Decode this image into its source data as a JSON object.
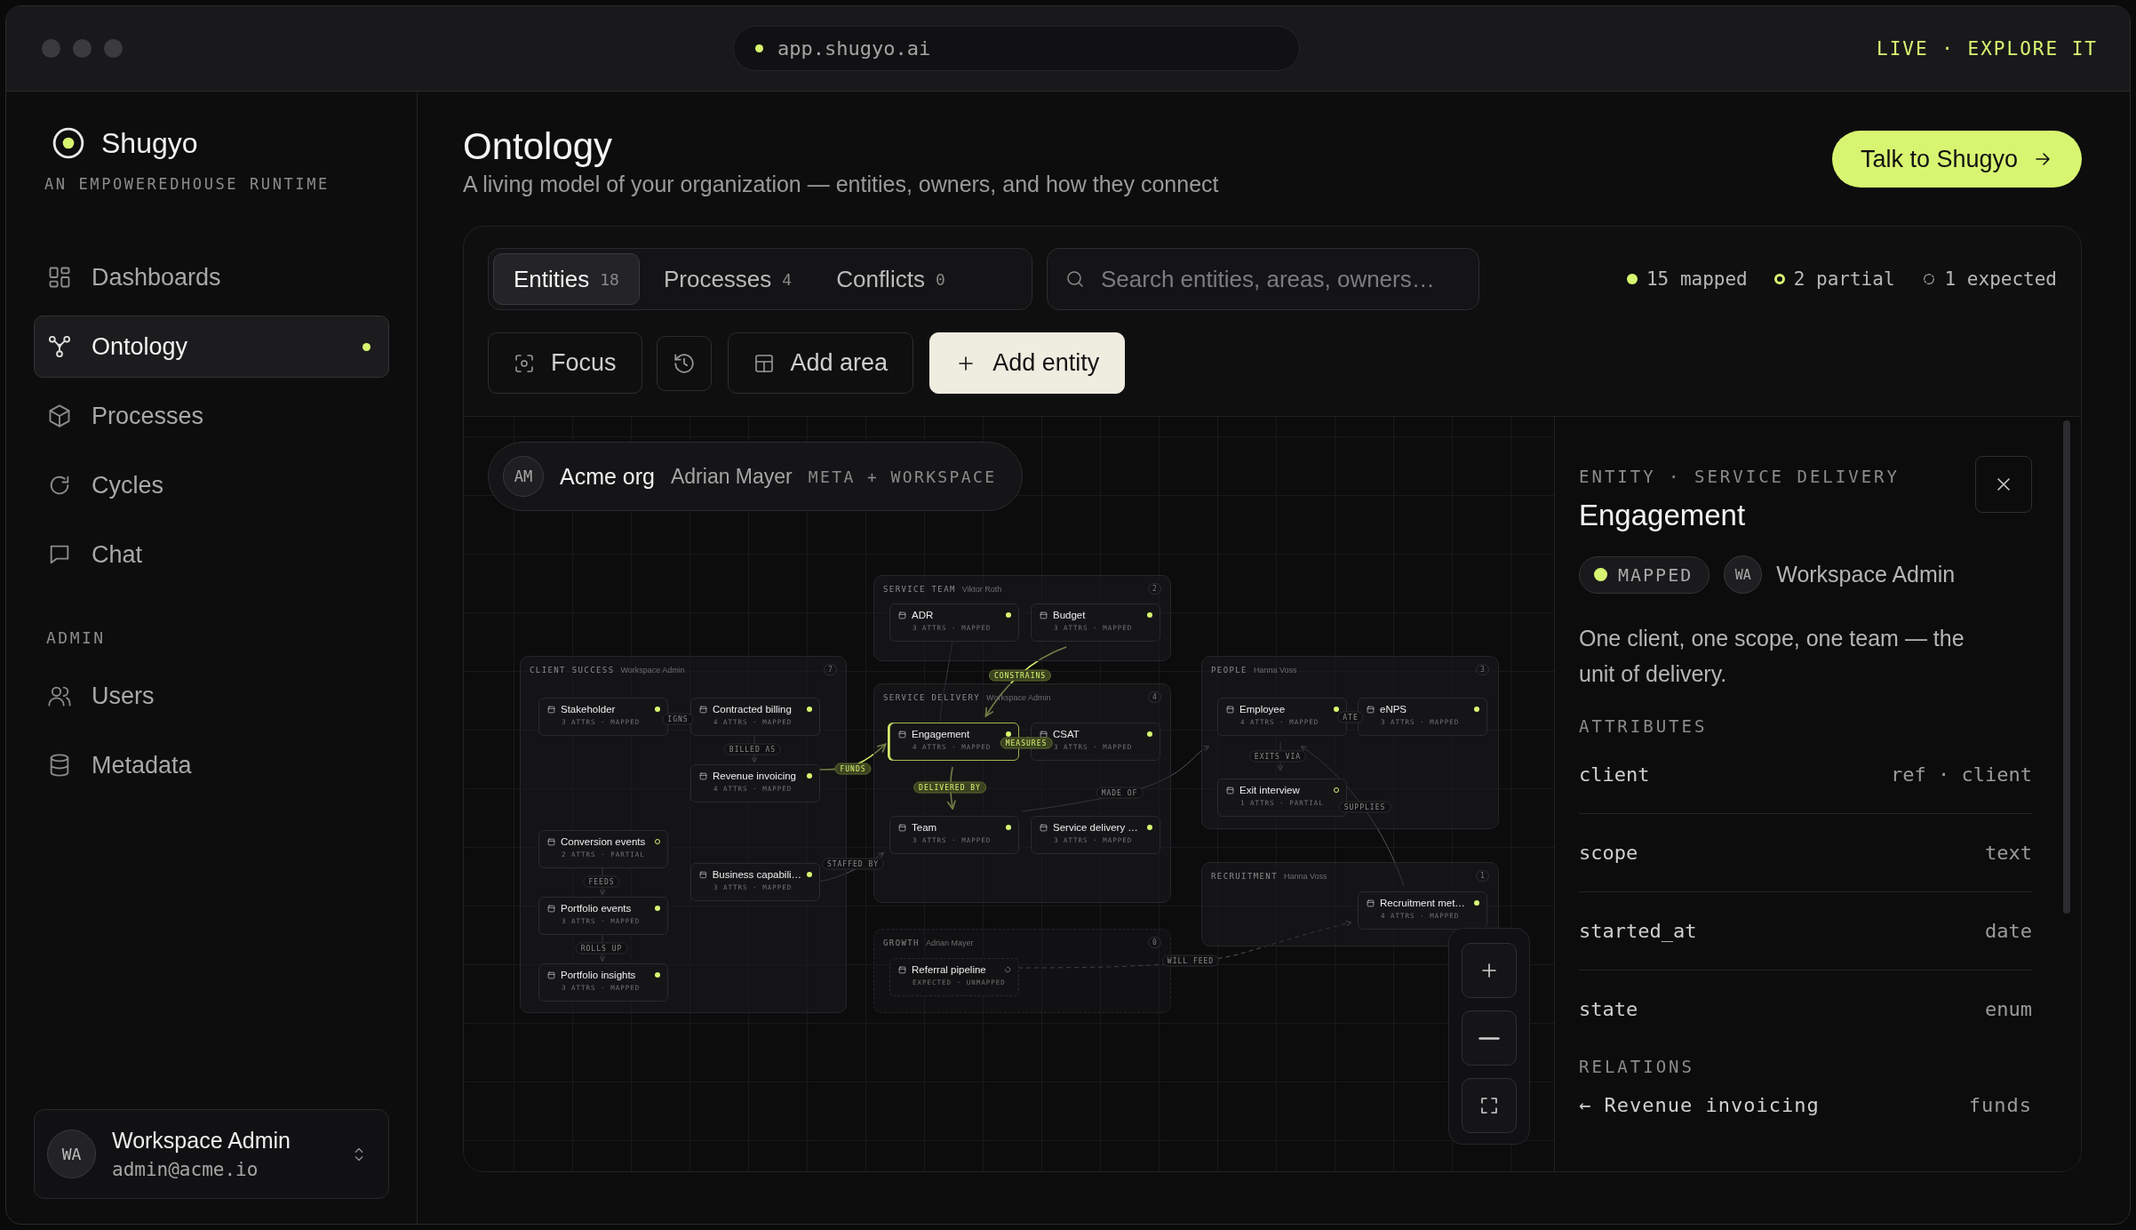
{
  "window": {
    "url": "app.shugyo.ai",
    "live_link": "LIVE · EXPLORE IT"
  },
  "sidebar": {
    "brand": "Shugyo",
    "tagline": "AN EMPOWEREDHOUSE RUNTIME",
    "items": [
      {
        "label": "Dashboards",
        "selected": false
      },
      {
        "label": "Ontology",
        "selected": true
      },
      {
        "label": "Processes",
        "selected": false
      },
      {
        "label": "Cycles",
        "selected": false
      },
      {
        "label": "Chat",
        "selected": false
      }
    ],
    "section_label": "ADMIN",
    "admin_items": [
      {
        "label": "Users",
        "selected": false
      },
      {
        "label": "Metadata",
        "selected": false
      }
    ],
    "user": {
      "initials": "WA",
      "name": "Workspace Admin",
      "email": "admin@acme.io"
    }
  },
  "header": {
    "title": "Ontology",
    "subtitle": "A living model of your organization — entities, owners, and how they connect",
    "action": "Talk to Shugyo"
  },
  "tabs": [
    {
      "label": "Entities",
      "count": "18",
      "selected": true
    },
    {
      "label": "Processes",
      "count": "4",
      "selected": false
    },
    {
      "label": "Conflicts",
      "count": "0",
      "selected": false
    }
  ],
  "search": {
    "placeholder": "Search entities, areas, owners…"
  },
  "legend": [
    {
      "kind": "mapped",
      "text": "15 mapped"
    },
    {
      "kind": "partial",
      "text": "2 partial"
    },
    {
      "kind": "expected",
      "text": "1 expected"
    }
  ],
  "toolbar": [
    {
      "kind": "focus",
      "label": "Focus"
    },
    {
      "kind": "history"
    },
    {
      "kind": "add-area",
      "label": "Add area"
    },
    {
      "kind": "add-entity",
      "label": "Add entity"
    }
  ],
  "canvas": {
    "org": {
      "initials": "AM",
      "name": "Acme org",
      "owner": "Adrian Mayer",
      "scope": "META + WORKSPACE"
    },
    "areas": [
      {
        "name": "CLIENT SUCCESS",
        "owner": "Workspace Admin",
        "count": "7",
        "expected": false,
        "nodes": [
          {
            "name": "Stakeholder",
            "meta": "3 ATTRS · MAPPED",
            "kind": "mapped",
            "selected": false
          },
          {
            "name": "Contracted billing",
            "meta": "4 ATTRS · MAPPED",
            "kind": "mapped",
            "selected": false
          },
          {
            "name": "Revenue invoicing",
            "meta": "4 ATTRS · MAPPED",
            "kind": "mapped",
            "selected": false
          },
          {
            "name": "Conversion events",
            "meta": "2 ATTRS · PARTIAL",
            "kind": "partial",
            "selected": false
          },
          {
            "name": "Business capabili…",
            "meta": "3 ATTRS · MAPPED",
            "kind": "mapped",
            "selected": false
          },
          {
            "name": "Portfolio events",
            "meta": "3 ATTRS · MAPPED",
            "kind": "mapped",
            "selected": false
          },
          {
            "name": "Portfolio insights",
            "meta": "3 ATTRS · MAPPED",
            "kind": "mapped",
            "selected": false
          }
        ]
      },
      {
        "name": "SERVICE TEAM",
        "owner": "Viktor Roth",
        "count": "2",
        "expected": false,
        "nodes": [
          {
            "name": "ADR",
            "meta": "3 ATTRS · MAPPED",
            "kind": "mapped",
            "selected": false
          },
          {
            "name": "Budget",
            "meta": "3 ATTRS · MAPPED",
            "kind": "mapped",
            "selected": false
          }
        ]
      },
      {
        "name": "SERVICE DELIVERY",
        "owner": "Workspace Admin",
        "count": "4",
        "expected": false,
        "nodes": [
          {
            "name": "Engagement",
            "meta": "4 ATTRS · MAPPED",
            "kind": "mapped",
            "selected": true
          },
          {
            "name": "CSAT",
            "meta": "3 ATTRS · MAPPED",
            "kind": "mapped",
            "selected": false
          },
          {
            "name": "Team",
            "meta": "3 ATTRS · MAPPED",
            "kind": "mapped",
            "selected": false
          },
          {
            "name": "Service delivery …",
            "meta": "3 ATTRS · MAPPED",
            "kind": "mapped",
            "selected": false
          }
        ]
      },
      {
        "name": "GROWTH",
        "owner": "Adrian Mayer",
        "count": "0",
        "expected": true,
        "nodes": [
          {
            "name": "Referral pipeline",
            "meta": "EXPECTED · UNMAPPED",
            "kind": "expected",
            "selected": false
          }
        ]
      },
      {
        "name": "PEOPLE",
        "owner": "Hanna Voss",
        "count": "3",
        "expected": false,
        "nodes": [
          {
            "name": "Employee",
            "meta": "4 ATTRS · MAPPED",
            "kind": "mapped",
            "selected": false
          },
          {
            "name": "eNPS",
            "meta": "3 ATTRS · MAPPED",
            "kind": "mapped",
            "selected": false
          },
          {
            "name": "Exit interview",
            "meta": "1 ATTRS · PARTIAL",
            "kind": "partial",
            "selected": false
          }
        ]
      },
      {
        "name": "RECRUITMENT",
        "owner": "Hanna Voss",
        "count": "1",
        "expected": false,
        "nodes": [
          {
            "name": "Recruitment met…",
            "meta": "4 ATTRS · MAPPED",
            "kind": "mapped",
            "selected": false
          }
        ]
      }
    ],
    "edge_labels": [
      {
        "text": "IGNS",
        "highlighted": false
      },
      {
        "text": "BILLED AS",
        "highlighted": false
      },
      {
        "text": "FUNDS",
        "highlighted": true
      },
      {
        "text": "FEEDS",
        "highlighted": false
      },
      {
        "text": "ROLLS UP",
        "highlighted": false
      },
      {
        "text": "STAFFED BY",
        "highlighted": false
      },
      {
        "text": "CONSTRAINS",
        "highlighted": true
      },
      {
        "text": "MEASURES",
        "highlighted": true
      },
      {
        "text": "DELIVERED BY",
        "highlighted": true
      },
      {
        "text": "MADE OF",
        "highlighted": false
      },
      {
        "text": "ATE",
        "highlighted": false
      },
      {
        "text": "EXITS VIA",
        "highlighted": false
      },
      {
        "text": "SUPPLIES",
        "highlighted": false
      },
      {
        "text": "WILL FEED",
        "highlighted": false
      }
    ]
  },
  "detail": {
    "eyebrow": "ENTITY · SERVICE DELIVERY",
    "title": "Engagement",
    "status": {
      "kind": "mapped",
      "label": "MAPPED"
    },
    "owner_initials": "WA",
    "owner": "Workspace Admin",
    "description": "One client, one scope, one team — the unit of delivery.",
    "attributes_label": "ATTRIBUTES",
    "attributes": [
      {
        "name": "client",
        "type": "ref · client"
      },
      {
        "name": "scope",
        "type": "text"
      },
      {
        "name": "started_at",
        "type": "date"
      },
      {
        "name": "state",
        "type": "enum"
      }
    ],
    "relations_label": "RELATIONS",
    "relations": [
      {
        "target": "← Revenue invoicing",
        "verb": "funds"
      }
    ]
  }
}
